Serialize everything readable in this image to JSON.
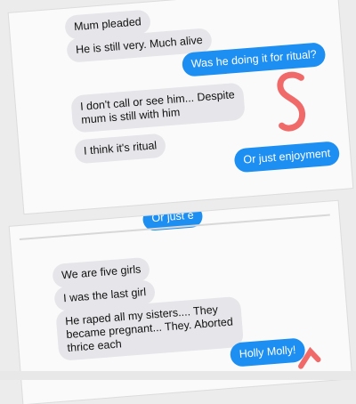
{
  "screenshot_top": {
    "messages": [
      {
        "side": "received",
        "text": "Mum pleaded"
      },
      {
        "side": "received",
        "text": "He is still very. Much alive"
      },
      {
        "side": "sent",
        "text": "Was he doing it for ritual?"
      },
      {
        "side": "received",
        "text": "I don't call or see him... Despite\nmum is still with him"
      },
      {
        "side": "received",
        "text": "I think it's ritual"
      },
      {
        "side": "sent",
        "text": "Or just enjoyment"
      }
    ]
  },
  "screenshot_bottom": {
    "partial_sent": "Or just e",
    "messages": [
      {
        "side": "received",
        "text": "We are five girls"
      },
      {
        "side": "received",
        "text": "I was the last girl"
      },
      {
        "side": "received",
        "text": "He raped all my sisters.... They\nbecame pregnant... They. Aborted\nthrice each"
      },
      {
        "side": "sent",
        "text": "Holly Molly!"
      }
    ]
  },
  "colors": {
    "sent_bubble": "#1d8ef2",
    "received_bubble": "#e6e6ea",
    "annotation_mark": "#f06a6a"
  }
}
